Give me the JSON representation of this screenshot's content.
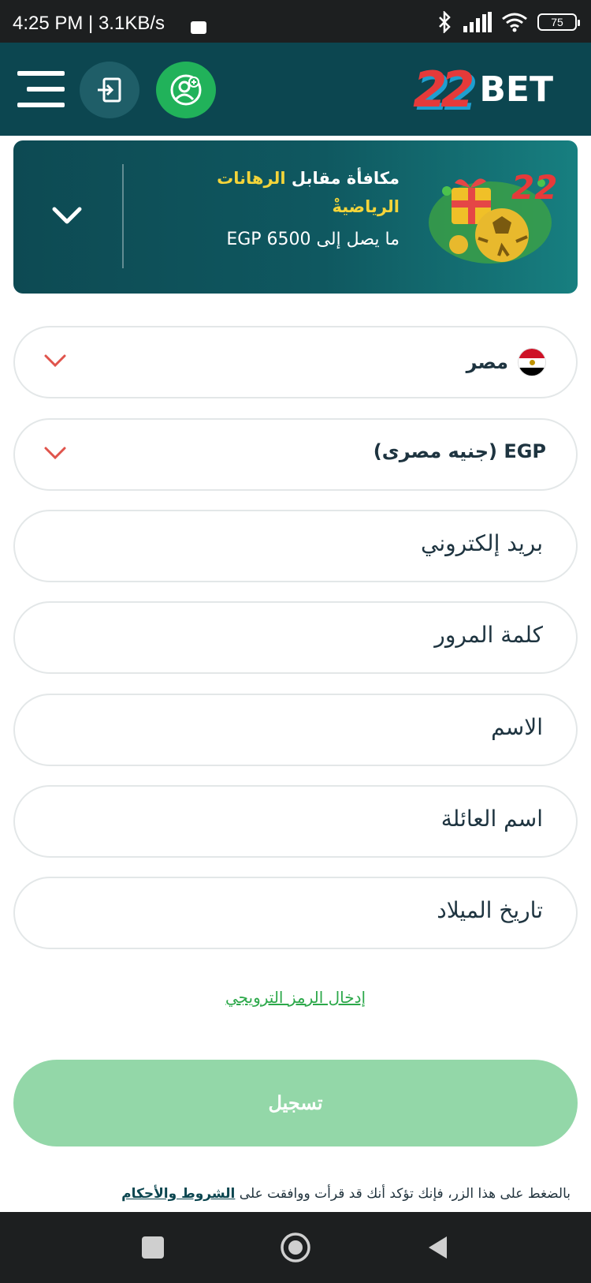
{
  "status_bar": {
    "time": "4:25 PM | 3.1KB/s",
    "battery": "75"
  },
  "header": {
    "logo_text": "BET",
    "logo_number": "22",
    "colors": {
      "bg": "#0c4650",
      "accent_green": "#21b25a"
    }
  },
  "bonus": {
    "title_part1": "مكافأة مقابل",
    "title_highlight": "الرهانات",
    "title_line2": "الرياضيةْ",
    "amount_text": "ما يصل إلى EGP 6500"
  },
  "form": {
    "country": "مصر",
    "currency": "EGP (جنيه مصرى)",
    "email_placeholder": "بريد إلكتروني",
    "password_placeholder": "كلمة المرور",
    "name_placeholder": "الاسم",
    "surname_placeholder": "اسم العائلة",
    "birthdate_placeholder": "تاريخ الميلاد",
    "promo_link": "إدخال الرمز الترويجي",
    "submit_label": "تسجيل"
  },
  "terms": {
    "text": "بالضغط على هذا الزر، فإنك تؤكد أنك قد قرأت ووافقت على",
    "link": "الشروط والأحكام"
  }
}
